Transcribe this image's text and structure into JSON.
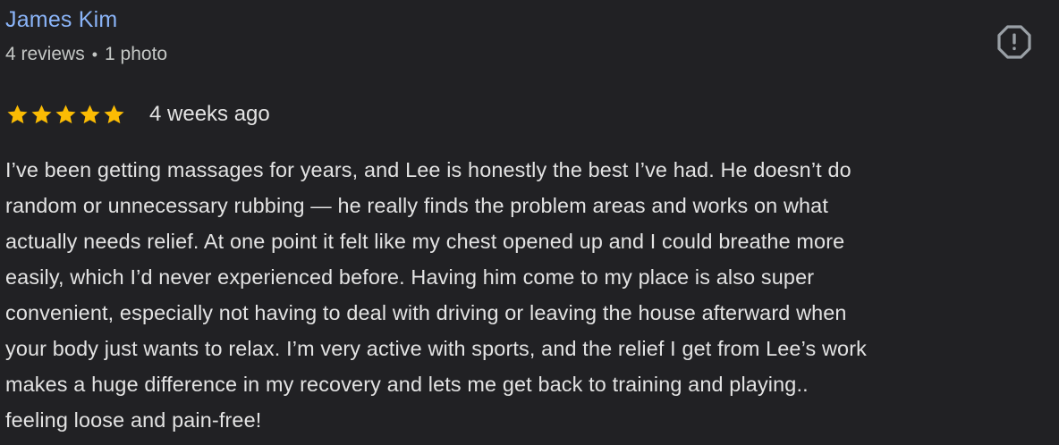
{
  "review": {
    "reviewer_name": "James Kim",
    "review_count": "4 reviews",
    "meta_separator": "•",
    "photo_count": "1 photo",
    "rating": 5,
    "max_rating": 5,
    "date": "4 weeks ago",
    "text_lines": [
      "I’ve been getting massages for years, and Lee is honestly the best I’ve had. He doesn’t do",
      "random or unnecessary rubbing — he really finds the problem areas and works on what",
      "actually needs relief. At one point it felt like my chest opened up and I could breathe more",
      "easily, which I’d never experienced before. Having him come to my place is also super",
      "convenient, especially not having to deal with driving or leaving the house afterward when",
      "your body just wants to relax. I’m very active with sports, and the relief I get from Lee’s work",
      "makes a huge difference in my recovery and lets me get back to training and playing..",
      "feeling loose and pain-free!"
    ]
  },
  "icons": {
    "report": "report-icon",
    "star": "star-icon"
  },
  "colors": {
    "background": "#212124",
    "name_link": "#8ab4f8",
    "star": "#fbbc04",
    "meta_text": "#c4c7c5",
    "body_text": "#e3e3e3"
  }
}
